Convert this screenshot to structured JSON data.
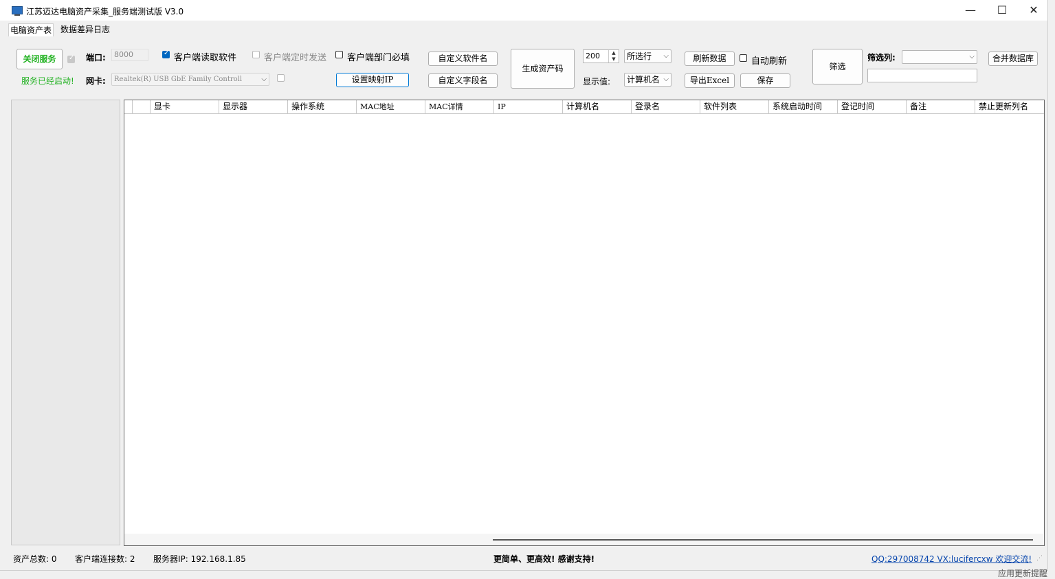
{
  "window": {
    "title": "江苏迈达电脑资产采集_服务端测试版 V3.0",
    "minimize_glyph": "—",
    "maximize_glyph": "☐",
    "close_glyph": "✕"
  },
  "tabs": [
    {
      "label": "电脑资产表",
      "active": true
    },
    {
      "label": "数据差异日志",
      "active": false
    }
  ],
  "toolbar": {
    "close_service_label": "关闭服务",
    "service_status": "服务已经启动!",
    "port_label": "端口:",
    "port_value": "8000",
    "nic_label": "网卡:",
    "nic_value": "Realtek(R) USB GbE Family Controll",
    "client_read_software": {
      "label": "客户端读取软件",
      "checked": true
    },
    "client_timed_send": {
      "label": "客户端定时发送",
      "checked": false,
      "disabled": true
    },
    "client_dept_required": {
      "label": "客户端部门必填",
      "checked": false
    },
    "set_mapping_ip_label": "设置映射IP",
    "custom_software_name_label": "自定义软件名",
    "custom_field_name_label": "自定义字段名",
    "generate_asset_code_label": "生成资产码",
    "rows_value": "200",
    "selected_rows_option": "所选行",
    "display_value_label": "显示值:",
    "display_value_option": "计算机名",
    "refresh_data_label": "刷新数据",
    "auto_refresh": {
      "label": "自动刷新",
      "checked": false
    },
    "export_excel_label": "导出Excel",
    "save_label": "保存",
    "filter_label": "筛选",
    "filter_column_label": "筛选列:",
    "filter_column_value": "",
    "filter_text_value": "",
    "merge_db_label": "合并数据库"
  },
  "grid": {
    "columns": [
      "",
      "显卡",
      "显示器",
      "操作系统",
      "MAC地址",
      "MAC详情",
      "IP",
      "计算机名",
      "登录名",
      "软件列表",
      "系统启动时间",
      "登记时间",
      "备注",
      "禁止更新列名"
    ],
    "rows": []
  },
  "status": {
    "asset_total": "资产总数: 0",
    "client_connections": "客户端连接数: 2",
    "server_ip": "服务器IP: 192.168.1.85",
    "slogan": "更简单、更高效! 感谢支持!",
    "contact_link": "QQ:297008742  VX:lucifercxw 欢迎交流!"
  },
  "background_text": "应用更新提醒",
  "colors": {
    "status_green": "#22b222",
    "link_blue": "#0645ad",
    "accent": "#0067c0"
  }
}
